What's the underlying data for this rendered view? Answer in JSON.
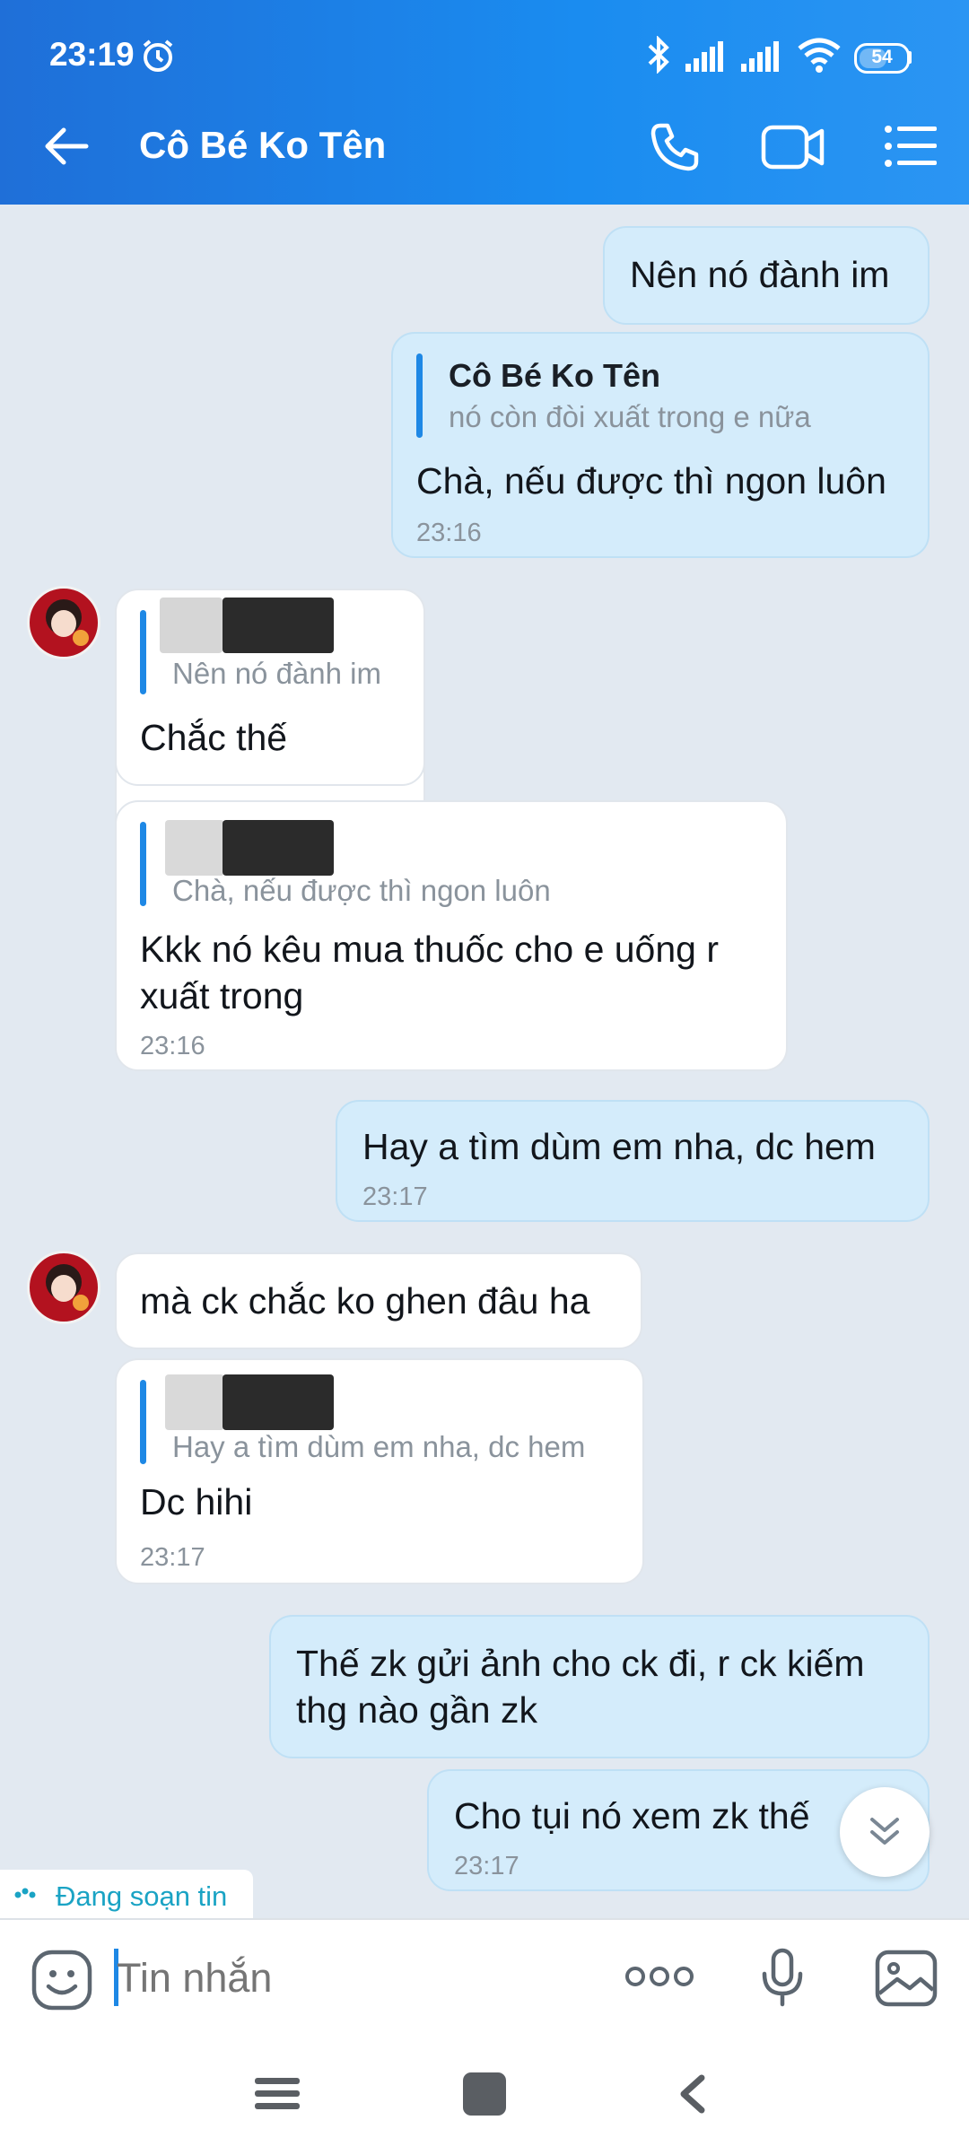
{
  "status_bar": {
    "time": "23:19",
    "battery": "54"
  },
  "header": {
    "title": "Cô Bé Ko Tên"
  },
  "messages": {
    "m1": {
      "text": "Nên nó đành im"
    },
    "m2": {
      "quote_name": "Cô Bé Ko Tên",
      "quote_text": "nó còn đòi xuất trong e nữa",
      "text": "Chà, nếu được thì ngon luôn",
      "time": "23:16"
    },
    "m3": {
      "quote_text": "Nên nó đành im",
      "text": "Chắc thế"
    },
    "m4": {
      "quote_text": "Chà, nếu được thì ngon luôn",
      "text_line1": "Kkk nó kêu mua thuốc cho e uống r",
      "text_line2": "xuất trong",
      "time": "23:16"
    },
    "m5": {
      "text": "Hay a tìm dùm em nha, dc hem",
      "time": "23:17"
    },
    "m6": {
      "text": "mà ck chắc ko ghen đâu ha"
    },
    "m7": {
      "quote_text": "Hay a tìm dùm em nha, dc hem",
      "text": "Dc hihi",
      "time": "23:17"
    },
    "m8": {
      "text_line1": "Thế zk gửi ảnh cho ck đi, r ck kiếm",
      "text_line2": "thg nào gần zk"
    },
    "m9": {
      "text": "Cho tụi nó xem zk thế ",
      "time": "23:17"
    }
  },
  "typing_indicator": {
    "label": "Đang soạn tin"
  },
  "composer": {
    "placeholder": "Tin nhắn"
  },
  "colors": {
    "header_blue": "#1a8cf0",
    "outgoing_bubble": "#d4ecfb",
    "incoming_bubble": "#ffffff",
    "chat_bg": "#e2e9f1",
    "quote_bar": "#1e88e5",
    "typing_teal": "#1aa3c4"
  }
}
